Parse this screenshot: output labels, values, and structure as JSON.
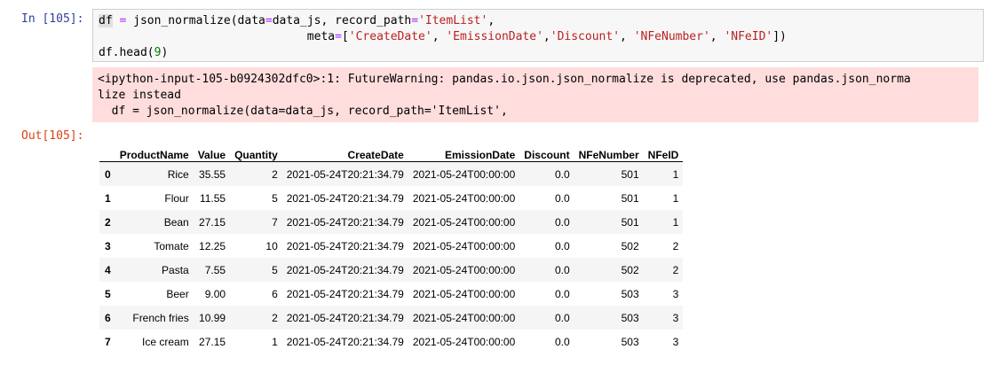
{
  "input_prompt": "In [105]:",
  "output_prompt": "Out[105]:",
  "code": {
    "l1_df": "df",
    "l1_a": " ",
    "l1_eq": "=",
    "l1_b": " json_normalize(data",
    "l1_eq2": "=",
    "l1_c": "data_js, record_path",
    "l1_eq3": "=",
    "l1_str": "'ItemList'",
    "l1_d": ",",
    "l2_indent": "                              meta",
    "l2_eq": "=",
    "l2_a": "[",
    "l2_s1": "'CreateDate'",
    "l2_c1": ", ",
    "l2_s2": "'EmissionDate'",
    "l2_c2": ",",
    "l2_s3": "'Discount'",
    "l2_c3": ", ",
    "l2_s4": "'NFeNumber'",
    "l2_c4": ", ",
    "l2_s5": "'NFeID'",
    "l2_end": "])",
    "l3_a": "df.head(",
    "l3_num": "9",
    "l3_b": ")"
  },
  "stderr": {
    "line1": "<ipython-input-105-b0924302dfc0>:1: FutureWarning: pandas.io.json.json_normalize is deprecated, use pandas.json_norma",
    "line2": "lize instead",
    "line3": "  df = json_normalize(data=data_js, record_path='ItemList',"
  },
  "table": {
    "columns": [
      "",
      "ProductName",
      "Value",
      "Quantity",
      "CreateDate",
      "EmissionDate",
      "Discount",
      "NFeNumber",
      "NFeID"
    ],
    "rows": [
      [
        "0",
        "Rice",
        "35.55",
        "2",
        "2021-05-24T20:21:34.79",
        "2021-05-24T00:00:00",
        "0.0",
        "501",
        "1"
      ],
      [
        "1",
        "Flour",
        "11.55",
        "5",
        "2021-05-24T20:21:34.79",
        "2021-05-24T00:00:00",
        "0.0",
        "501",
        "1"
      ],
      [
        "2",
        "Bean",
        "27.15",
        "7",
        "2021-05-24T20:21:34.79",
        "2021-05-24T00:00:00",
        "0.0",
        "501",
        "1"
      ],
      [
        "3",
        "Tomate",
        "12.25",
        "10",
        "2021-05-24T20:21:34.79",
        "2021-05-24T00:00:00",
        "0.0",
        "502",
        "2"
      ],
      [
        "4",
        "Pasta",
        "7.55",
        "5",
        "2021-05-24T20:21:34.79",
        "2021-05-24T00:00:00",
        "0.0",
        "502",
        "2"
      ],
      [
        "5",
        "Beer",
        "9.00",
        "6",
        "2021-05-24T20:21:34.79",
        "2021-05-24T00:00:00",
        "0.0",
        "503",
        "3"
      ],
      [
        "6",
        "French fries",
        "10.99",
        "2",
        "2021-05-24T20:21:34.79",
        "2021-05-24T00:00:00",
        "0.0",
        "503",
        "3"
      ],
      [
        "7",
        "Ice cream",
        "27.15",
        "1",
        "2021-05-24T20:21:34.79",
        "2021-05-24T00:00:00",
        "0.0",
        "503",
        "3"
      ]
    ]
  }
}
